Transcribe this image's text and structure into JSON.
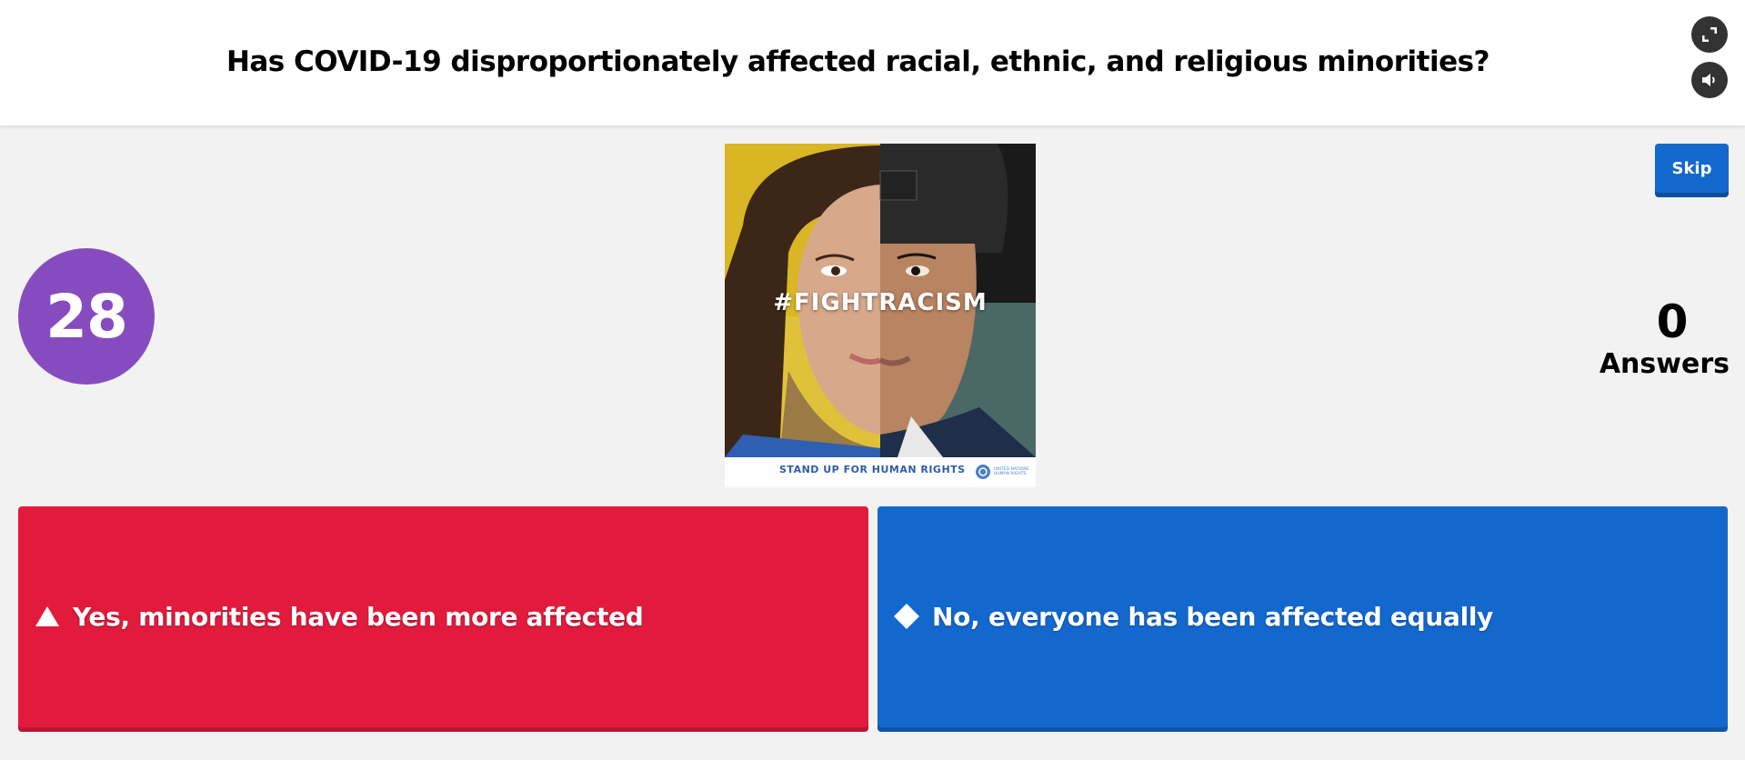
{
  "question": {
    "text": "Has COVID-19 disproportionately affected racial, ethnic, and religious minorities?"
  },
  "controls": {
    "fullscreen_icon": "fullscreen-icon",
    "volume_icon": "volume-icon",
    "skip_label": "Skip"
  },
  "timer": {
    "value": "28",
    "color": "#864cbf"
  },
  "answers": {
    "count": "0",
    "label": "Answers"
  },
  "media": {
    "hashtag": "#FIGHTRACISM",
    "caption": "STAND UP FOR HUMAN RIGHTS",
    "logo_text": "UNITED NATIONS HUMAN RIGHTS"
  },
  "options": [
    {
      "shape": "triangle-icon",
      "text": "Yes, minorities have been more affected",
      "color": "#e21b3c"
    },
    {
      "shape": "diamond-icon",
      "text": "No, everyone has been affected equally",
      "color": "#1368ce"
    }
  ]
}
